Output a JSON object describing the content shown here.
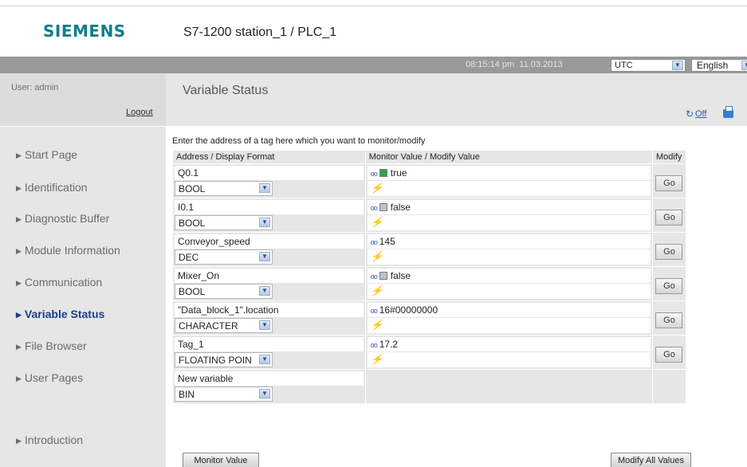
{
  "brand": {
    "logo": "SIEMENS",
    "station": "S7-1200 station_1 / PLC_1"
  },
  "statusbar": {
    "time": "08:15:14 pm",
    "date": "11.03.2013",
    "timezone": "UTC",
    "language": "English"
  },
  "user": {
    "label": "User: admin",
    "logout": "Logout"
  },
  "nav": {
    "items": [
      {
        "label": "Start Page"
      },
      {
        "label": "Identification"
      },
      {
        "label": "Diagnostic Buffer"
      },
      {
        "label": "Module Information"
      },
      {
        "label": "Communication"
      },
      {
        "label": "Variable Status",
        "active": true
      },
      {
        "label": "File Browser"
      },
      {
        "label": "User Pages"
      },
      {
        "label": "Introduction"
      }
    ]
  },
  "page": {
    "title": "Variable Status",
    "toolbar_off": "Off",
    "hint": "Enter the address of a tag here which you want to monitor/modify"
  },
  "table": {
    "headers": [
      "Address / Display Format",
      "Monitor Value / Modify Value",
      "Modify"
    ],
    "rows": [
      {
        "address": "Q0.1",
        "format": "BOOL",
        "value": "true",
        "state": "on",
        "go": "Go"
      },
      {
        "address": "I0.1",
        "format": "BOOL",
        "value": "false",
        "state": "off",
        "go": "Go"
      },
      {
        "address": "Conveyor_speed",
        "format": "DEC",
        "value": "145",
        "go": "Go"
      },
      {
        "address": "Mixer_On",
        "format": "BOOL",
        "value": "false",
        "state": "off",
        "go": "Go"
      },
      {
        "address": "\"Data_block_1\".location",
        "format": "CHARACTER",
        "value": "16#00000000",
        "go": "Go"
      },
      {
        "address": "Tag_1",
        "format": "FLOATING POIN",
        "value": "17.2",
        "go": "Go"
      },
      {
        "address": "New variable",
        "format": "BIN"
      }
    ]
  },
  "buttons": {
    "monitor": "Monitor Value",
    "modify_all": "Modify All Values"
  },
  "colors": {
    "brand": "#0f7e8c",
    "active_nav": "#1a3e8c",
    "status_on": "#2ea83d",
    "status_off": "#b9c3d6"
  }
}
